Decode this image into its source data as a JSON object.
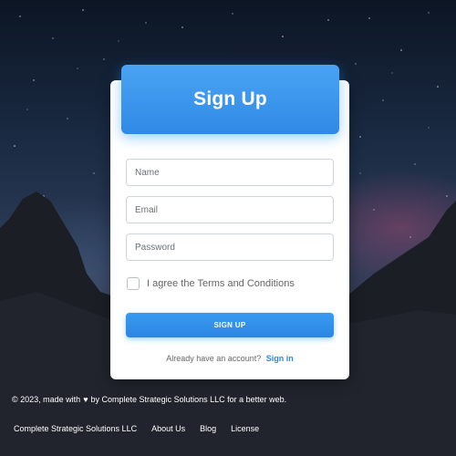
{
  "card": {
    "title": "Sign Up",
    "fields": {
      "name_placeholder": "Name",
      "email_placeholder": "Email",
      "password_placeholder": "Password"
    },
    "terms_label": "I agree the Terms and Conditions",
    "terms_checked": false,
    "submit_label": "SIGN UP",
    "signin_prompt": "Already have an account?",
    "signin_link": "Sign in"
  },
  "footer": {
    "copyright_prefix": "© 2023, made with",
    "heart_icon": "heart-icon",
    "copyright_suffix": "by Complete Strategic Solutions LLC for a better web.",
    "links": [
      "Complete Strategic Solutions LLC",
      "About Us",
      "Blog",
      "License"
    ]
  },
  "colors": {
    "accent": "#2b86e3",
    "header_gradient_top": "#4aa3f3"
  }
}
